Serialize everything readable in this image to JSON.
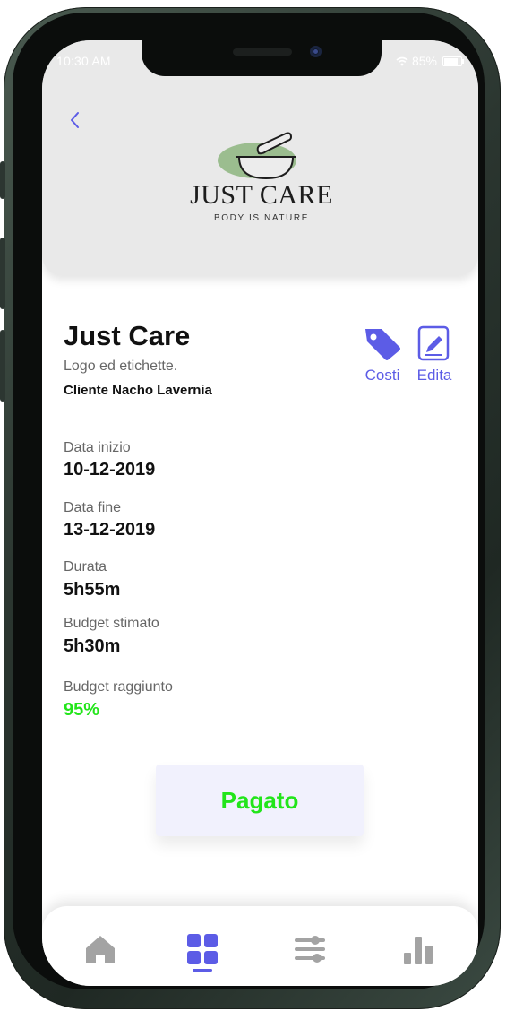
{
  "status_bar": {
    "time": "10:30 AM",
    "battery": "85%",
    "icons": [
      "wifi-icon",
      "battery-icon"
    ]
  },
  "header": {
    "back_icon": "chevron-left-icon",
    "logo": {
      "title": "JUST CARE",
      "subtitle": "BODY IS NATURE",
      "icon": "mortar-pestle-icon",
      "accent": "#9bbd8f"
    }
  },
  "project": {
    "title": "Just Care",
    "description": "Logo ed etichette.",
    "client": "Cliente Nacho Lavernia"
  },
  "actions": [
    {
      "label": "Costi",
      "icon": "tag-icon"
    },
    {
      "label": "Edita",
      "icon": "edit-icon"
    }
  ],
  "fields": [
    {
      "label": "Data inizio",
      "value": "10-12-2019"
    },
    {
      "label": "Data fine",
      "value": "13-12-2019"
    },
    {
      "label": "Durata",
      "value": "5h55m"
    },
    {
      "label": "Budget stimato",
      "value": "5h30m"
    },
    {
      "label": "Budget raggiunto",
      "value": "95%"
    }
  ],
  "pay_button": {
    "label": "Pagato"
  },
  "bottom_nav": {
    "items": [
      {
        "icon": "home-icon",
        "active": false
      },
      {
        "icon": "grid-icon",
        "active": true
      },
      {
        "icon": "sliders-icon",
        "active": false
      },
      {
        "icon": "bar-chart-icon",
        "active": false
      }
    ]
  },
  "colors": {
    "accent": "#5c5ce6",
    "success": "#22e51a",
    "header_bg": "#e9e9e9",
    "inactive_icon": "#a3a3a3"
  }
}
